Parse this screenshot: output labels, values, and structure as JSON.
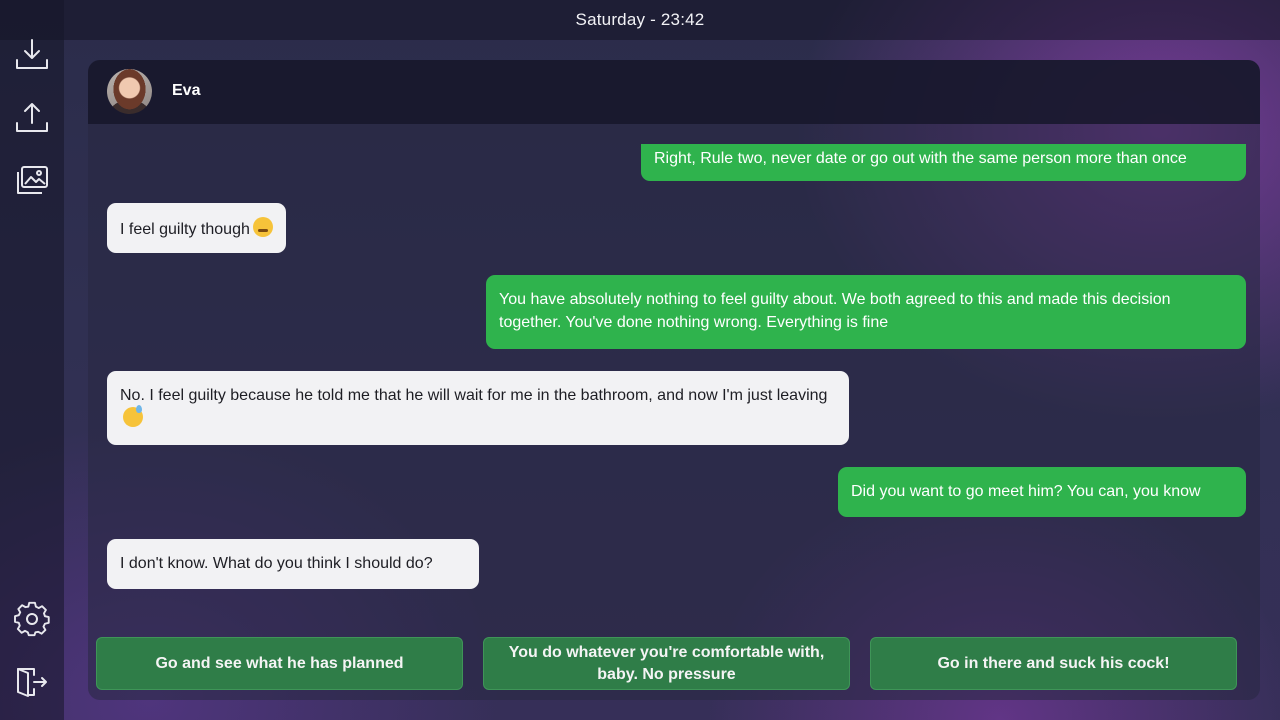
{
  "status_bar": {
    "clock": "Saturday - 23:42"
  },
  "sidebar": {
    "items": [
      {
        "name": "download-icon",
        "action": "save"
      },
      {
        "name": "upload-icon",
        "action": "load"
      },
      {
        "name": "gallery-icon",
        "action": "gallery"
      },
      {
        "name": "gear-icon",
        "action": "settings"
      },
      {
        "name": "exit-icon",
        "action": "exit"
      }
    ]
  },
  "chat": {
    "contact_name": "Eva",
    "messages": [
      {
        "from": "me",
        "text": "Right, Rule two, never date or go out with the same person more than once"
      },
      {
        "from": "eva",
        "text": "I feel guilty though",
        "emoji": "persevering-face"
      },
      {
        "from": "me",
        "text": "You have absolutely nothing to feel guilty about. We both agreed to this and made this decision together. You've done nothing wrong. Everything is fine"
      },
      {
        "from": "eva",
        "text": "No. I feel guilty because he told me that he will wait for me in the bathroom, and now I'm just leaving",
        "emoji": "grinning-sweat-face"
      },
      {
        "from": "me",
        "text": "Did you want to go meet him? You can, you know"
      },
      {
        "from": "eva",
        "text": "I don't know. What do you think I should do?"
      }
    ]
  },
  "choices": [
    {
      "label": "Go and see what he has planned"
    },
    {
      "label": "You do whatever you're comfortable with, baby. No pressure"
    },
    {
      "label": "Go in there and suck his cock!"
    }
  ],
  "colors": {
    "outgoing_bubble": "#2fb34d",
    "incoming_bubble": "#f2f2f4",
    "choice_button": "#2f7d48"
  }
}
